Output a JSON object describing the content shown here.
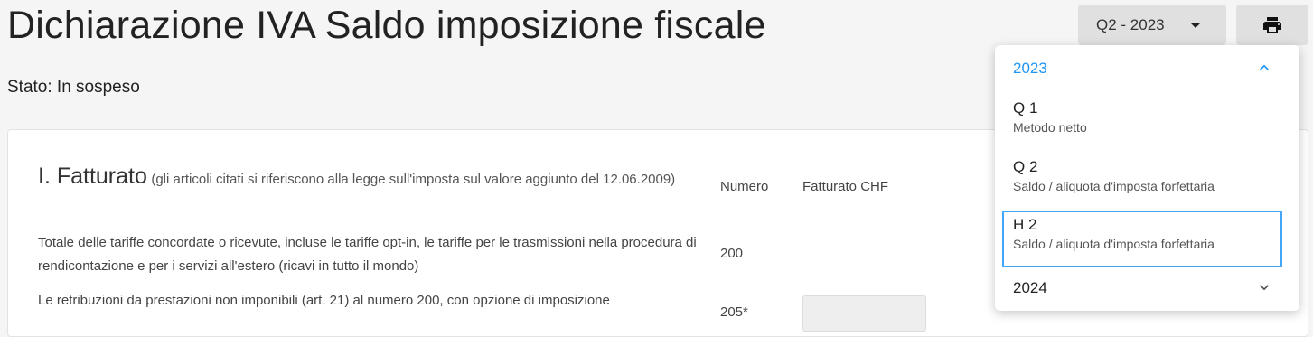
{
  "header": {
    "title": "Dichiarazione IVA Saldo imposizione fiscale",
    "status": "Stato: In sospeso",
    "period_button": "Q2 - 2023",
    "print_icon": "printer-icon"
  },
  "section": {
    "heading": "I. Fatturato",
    "heading_note": "(gli articoli citati si riferiscono alla legge sull'imposta sul valore aggiunto del 12.06.2009)",
    "columns": {
      "number": "Numero",
      "amount": "Fatturato CHF"
    },
    "rows": [
      {
        "description": "Totale delle tariffe concordate o ricevute, incluse le tariffe opt-in, le tariffe per le trasmissioni nella procedura di rendicontazione e per i servizi all'estero (ricavi in tutto il mondo)",
        "number": "200"
      },
      {
        "description": "Le retribuzioni da prestazioni non imponibili (art. 21) al numero 200, con opzione di imposizione",
        "number": "205*"
      }
    ]
  },
  "dropdown": {
    "years": [
      {
        "label": "2023",
        "expanded": true,
        "chevron_icon": "chevron-up-icon"
      },
      {
        "label": "2024",
        "expanded": false,
        "chevron_icon": "chevron-down-icon"
      }
    ],
    "items": [
      {
        "title": "Q 1",
        "subtitle": "Metodo netto",
        "selected": false
      },
      {
        "title": "Q 2",
        "subtitle": "Saldo / aliquota d'imposta forfettaria",
        "selected": false
      },
      {
        "title": "H 2",
        "subtitle": "Saldo / aliquota d'imposta forfettaria",
        "selected": true
      }
    ]
  },
  "colors": {
    "accent": "#2196f3",
    "button_bg": "#e0e0e0",
    "page_bg": "#f5f5f5"
  }
}
